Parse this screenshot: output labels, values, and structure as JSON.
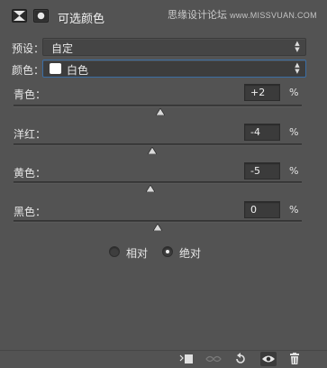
{
  "header": {
    "title": "可选颜色",
    "watermark_text": "思缘设计论坛",
    "watermark_url": "www.MISSVUAN.COM"
  },
  "preset": {
    "label": "预设：",
    "value": "自定"
  },
  "colors": {
    "label": "颜色：",
    "value": "白色",
    "swatch_color": "#ffffff"
  },
  "sliders": [
    {
      "label": "青色：",
      "value": "+2",
      "unit": "%",
      "percent": 2
    },
    {
      "label": "洋红：",
      "value": "-4",
      "unit": "%",
      "percent": -4
    },
    {
      "label": "黄色：",
      "value": "-5",
      "unit": "%",
      "percent": -5
    },
    {
      "label": "黑色：",
      "value": "0",
      "unit": "%",
      "percent": 0
    }
  ],
  "method": {
    "options": [
      {
        "label": "相对",
        "selected": false
      },
      {
        "label": "绝对",
        "selected": true
      }
    ]
  },
  "toolbar": {
    "buttons": [
      "clip-to-layer-icon",
      "view-previous-icon",
      "reset-icon",
      "visibility-icon",
      "delete-icon"
    ]
  }
}
